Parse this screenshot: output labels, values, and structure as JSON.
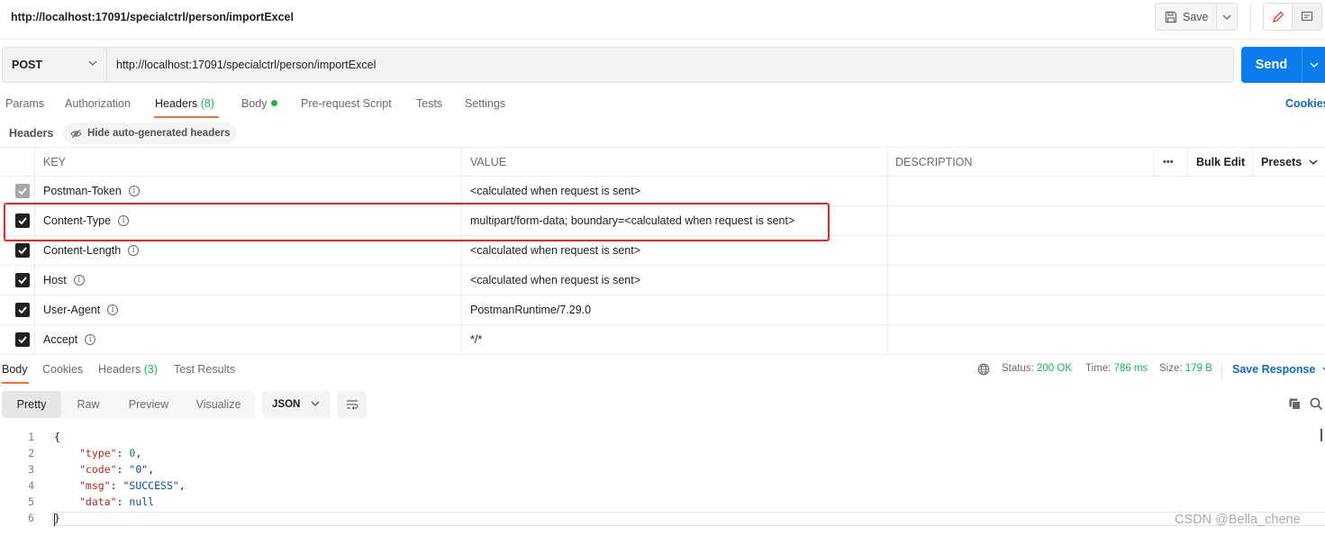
{
  "header": {
    "title": "http://localhost:17091/specialctrl/person/importExcel",
    "save_label": "Save"
  },
  "request": {
    "method": "POST",
    "url": "http://localhost:17091/specialctrl/person/importExcel",
    "send_label": "Send"
  },
  "req_tabs": {
    "params": "Params",
    "authorization": "Authorization",
    "headers": "Headers",
    "headers_count": "(8)",
    "body": "Body",
    "prerequest": "Pre-request Script",
    "tests": "Tests",
    "settings": "Settings",
    "cookies": "Cookies"
  },
  "headers_section": {
    "title": "Headers",
    "hide_auto": "Hide auto-generated headers"
  },
  "table": {
    "columns": {
      "key": "KEY",
      "value": "VALUE",
      "description": "DESCRIPTION",
      "more": "•••",
      "bulk_edit": "Bulk Edit",
      "presets": "Presets"
    },
    "rows": [
      {
        "key": "Postman-Token",
        "value": "<calculated when request is sent>",
        "checked": true,
        "disabled": true
      },
      {
        "key": "Content-Type",
        "value": "multipart/form-data; boundary=<calculated when request is sent>",
        "checked": true,
        "disabled": false
      },
      {
        "key": "Content-Length",
        "value": "<calculated when request is sent>",
        "checked": true,
        "disabled": false
      },
      {
        "key": "Host",
        "value": "<calculated when request is sent>",
        "checked": true,
        "disabled": false
      },
      {
        "key": "User-Agent",
        "value": "PostmanRuntime/7.29.0",
        "checked": true,
        "disabled": false
      },
      {
        "key": "Accept",
        "value": "*/*",
        "checked": true,
        "disabled": false
      }
    ],
    "info_glyph": "i"
  },
  "response": {
    "tabs": {
      "body": "Body",
      "cookies": "Cookies",
      "headers": "Headers",
      "headers_count": "(3)",
      "test_results": "Test Results"
    },
    "status_label": "Status:",
    "status_value": "200 OK",
    "time_label": "Time:",
    "time_value": "786 ms",
    "size_label": "Size:",
    "size_value": "179 B",
    "save_response": "Save Response",
    "views": {
      "pretty": "Pretty",
      "raw": "Raw",
      "preview": "Preview",
      "visualize": "Visualize"
    },
    "format": "JSON"
  },
  "code": {
    "line_numbers": [
      "1",
      "2",
      "3",
      "4",
      "5",
      "6"
    ],
    "open_brace": "{",
    "close_brace": "}",
    "lines": [
      {
        "key": "\"type\"",
        "value": "0",
        "trail": ","
      },
      {
        "key": "\"code\"",
        "value": "\"0\"",
        "trail": ","
      },
      {
        "key": "\"msg\"",
        "value": "\"SUCCESS\"",
        "trail": ","
      },
      {
        "key": "\"data\"",
        "value": "null",
        "trail": ""
      }
    ]
  },
  "watermark": "CSDN @Bella_chene",
  "colors": {
    "accent": "#ff6c37",
    "send": "#097bed",
    "ok": "#0cbb52",
    "highlight": "#e8281e"
  }
}
